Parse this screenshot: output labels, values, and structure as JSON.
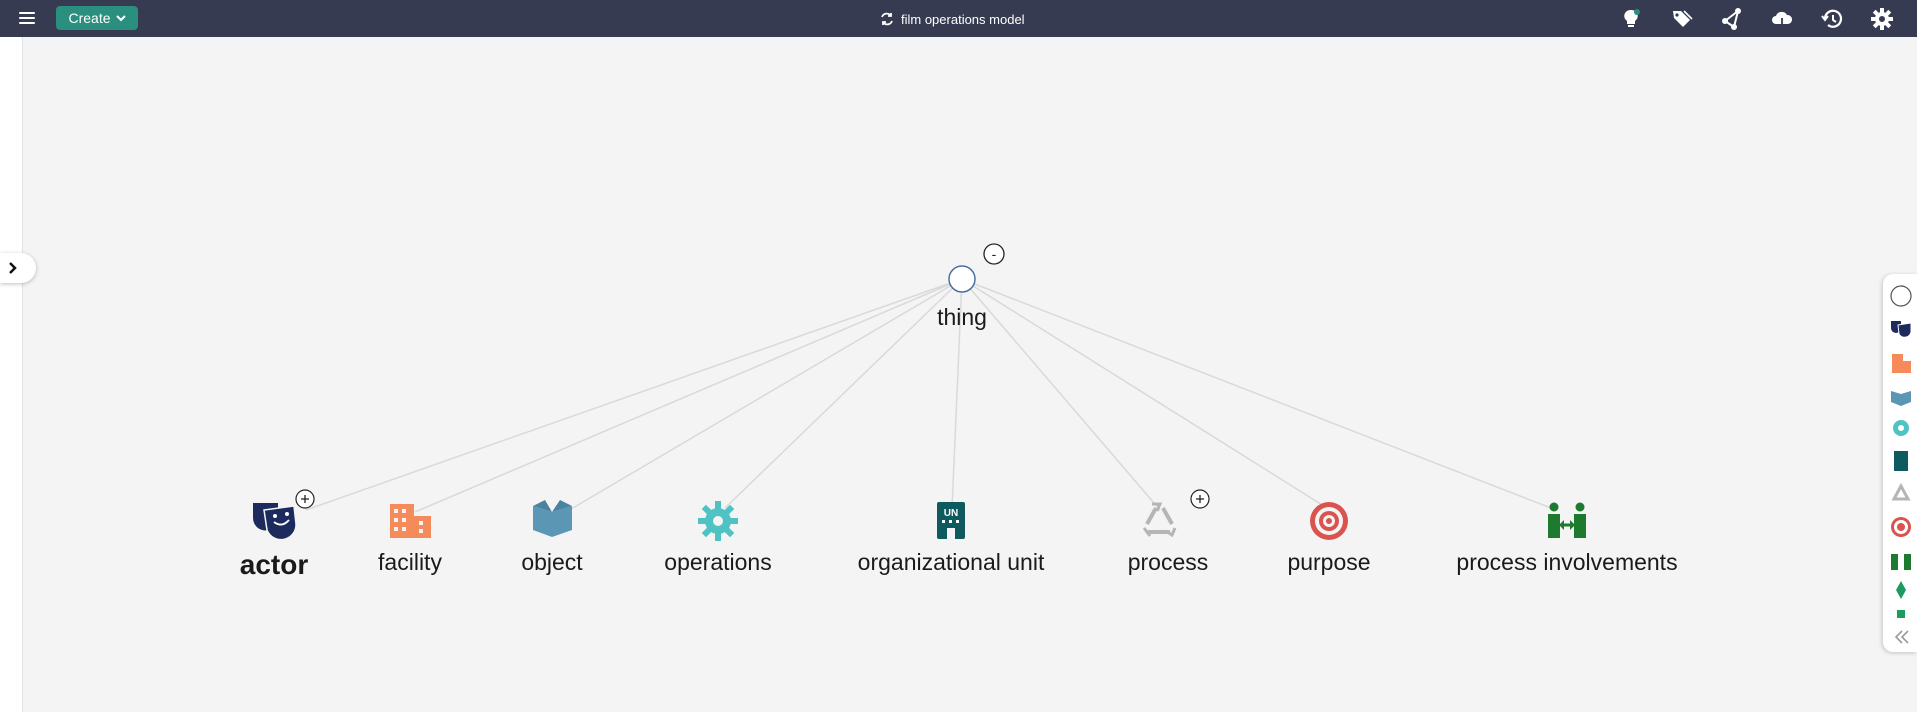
{
  "toolbar": {
    "create_label": "Create",
    "model_title": "film operations model",
    "icons": [
      "lightbulb-icon",
      "tags-icon",
      "share-icon",
      "cloud-icon",
      "history-icon",
      "gear-icon"
    ]
  },
  "graph": {
    "root": {
      "label": "thing",
      "icon": "circle-icon",
      "toggle": "-"
    },
    "children": [
      {
        "label": "actor",
        "icon": "theater-masks-icon",
        "expand": "+"
      },
      {
        "label": "facility",
        "icon": "building-icon"
      },
      {
        "label": "object",
        "icon": "open-box-icon"
      },
      {
        "label": "operations",
        "icon": "cog-icon"
      },
      {
        "label": "organizational unit",
        "icon": "un-building-icon"
      },
      {
        "label": "process",
        "icon": "recycle-icon",
        "expand": "+"
      },
      {
        "label": "purpose",
        "icon": "target-icon"
      },
      {
        "label": "process involvements",
        "icon": "people-arrows-icon"
      }
    ]
  },
  "palette": {
    "items": [
      "circle-icon",
      "theater-masks-icon",
      "building-icon",
      "open-box-icon",
      "cog-icon",
      "un-building-icon",
      "recycle-icon",
      "target-icon",
      "people-arrows-icon",
      "diamond-icon",
      "square-icon",
      "collapse-icon"
    ]
  },
  "colors": {
    "topbar": "#363b51",
    "accent": "#2a8f7e",
    "actor": "#1c2a5e",
    "facility": "#f58a5a",
    "object": "#5b97b5",
    "operations": "#4fc2c4",
    "org_unit": "#0e5a5e",
    "process": "#b5b5b5",
    "purpose": "#d9534f",
    "involvements": "#1e7a2e"
  }
}
